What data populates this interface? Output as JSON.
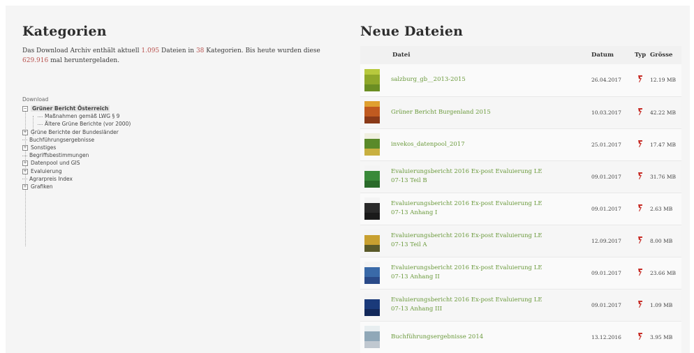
{
  "kategorien": {
    "title": "Kategorien",
    "intro_prefix": "Das Download Archiv enthält aktuell ",
    "file_count": "1.095",
    "intro_mid1": " Dateien in ",
    "category_count": "38",
    "intro_mid2": " Kategorien. Bis heute wurden diese ",
    "download_count": "629.916",
    "intro_suffix": " mal heruntergeladen."
  },
  "tree": {
    "root_label": "Download",
    "items": [
      {
        "label": "Grüner Bericht Österreich",
        "toggle": "−",
        "selected": true
      },
      {
        "label": "Maßnahmen gemäß LWG § 9",
        "child": true
      },
      {
        "label": "Ältere Grüne Berichte (vor 2000)",
        "child": true
      },
      {
        "label": "Grüne Berichte der Bundesländer",
        "toggle": "+"
      },
      {
        "label": "Buchführungsergebnisse"
      },
      {
        "label": "Sonstiges",
        "toggle": "+"
      },
      {
        "label": "Begriffsbestimmungen"
      },
      {
        "label": "Datenpool und GIS",
        "toggle": "+"
      },
      {
        "label": "Evaluierung",
        "toggle": "+"
      },
      {
        "label": "Agrarpreis Index"
      },
      {
        "label": "Grafiken",
        "toggle": "+"
      }
    ]
  },
  "neue_dateien": {
    "title": "Neue Dateien",
    "columns": {
      "name": "Datei",
      "date": "Datum",
      "type": "Typ",
      "size": "Grösse"
    },
    "rows": [
      {
        "name_l1": "salzburg_gb__2013-2015",
        "name_l2": "",
        "date": "26.04.2017",
        "size": "12.19 MB",
        "thumb": [
          "#b7c93d",
          "#8fa82a",
          "#6b8e23"
        ]
      },
      {
        "name_l1": "Grüner Bericht Burgenland 2015",
        "name_l2": "",
        "date": "10.03.2017",
        "size": "42.22 MB",
        "thumb": [
          "#e0a030",
          "#c05a20",
          "#8a3a18"
        ]
      },
      {
        "name_l1": "invekos_datenpool_2017",
        "name_l2": "",
        "date": "25.01.2017",
        "size": "17.47 MB",
        "thumb": [
          "#f0f0e0",
          "#5a8a2a",
          "#c8b040"
        ]
      },
      {
        "name_l1": "Evaluierungsbericht 2016 Ex-post Evaluierung LE",
        "name_l2": "07-13 Teil B",
        "date": "09.01.2017",
        "size": "31.76 MB",
        "thumb": [
          "#f4f4f4",
          "#3a8a3a",
          "#2a6a2a"
        ]
      },
      {
        "name_l1": "Evaluierungsbericht 2016 Ex-post Evaluierung LE",
        "name_l2": "07-13 Anhang I",
        "date": "09.01.2017",
        "size": "2.63 MB",
        "thumb": [
          "#f4f4f4",
          "#2a2a2a",
          "#1a1a1a"
        ]
      },
      {
        "name_l1": "Evaluierungsbericht 2016 Ex-post Evaluierung LE",
        "name_l2": "07-13 Teil A",
        "date": "12.09.2017",
        "size": "8.00 MB",
        "thumb": [
          "#f4f4f4",
          "#c8a030",
          "#5a5a2a"
        ]
      },
      {
        "name_l1": "Evaluierungsbericht 2016 Ex-post Evaluierung LE",
        "name_l2": "07-13 Anhang II",
        "date": "09.01.2017",
        "size": "23.66 MB",
        "thumb": [
          "#f4f4f4",
          "#3a6aa8",
          "#2a4a88"
        ]
      },
      {
        "name_l1": "Evaluierungsbericht 2016 Ex-post Evaluierung LE",
        "name_l2": "07-13 Anhang III",
        "date": "09.01.2017",
        "size": "1.09 MB",
        "thumb": [
          "#f4f4f4",
          "#1a3a7a",
          "#12285a"
        ]
      },
      {
        "name_l1": "Buchführungsergebnisse 2014",
        "name_l2": "",
        "date": "13.12.2016",
        "size": "3.95 MB",
        "thumb": [
          "#e8eef0",
          "#90a8b8",
          "#c0c8d0"
        ]
      }
    ]
  },
  "colors": {
    "link_green": "#6b9a3c",
    "highlight_red": "#b8504c",
    "pdf_red": "#c8302a"
  },
  "icons": {
    "pdf": "pdf-file-icon",
    "toggle": "tree-toggle-icon"
  }
}
